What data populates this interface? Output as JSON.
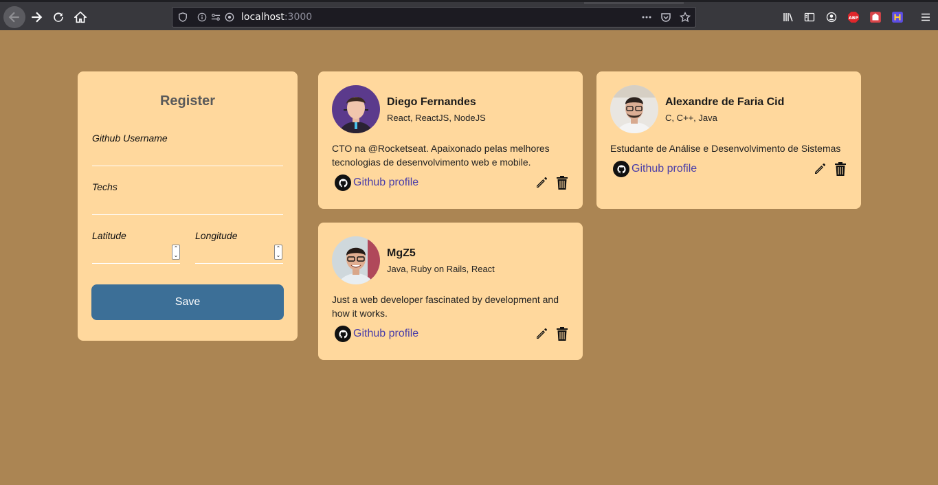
{
  "browser": {
    "url_host": "localhost",
    "url_port": ":3000"
  },
  "register": {
    "title": "Register",
    "github_username_label": "Github Username",
    "github_username_value": "",
    "techs_label": "Techs",
    "techs_value": "",
    "latitude_label": "Latitude",
    "latitude_value": "",
    "longitude_label": "Longitude",
    "longitude_value": "",
    "save_label": "Save"
  },
  "devs": [
    {
      "name": "Diego Fernandes",
      "techs": "React, ReactJS, NodeJS",
      "bio": "CTO na @Rocketseat. Apaixonado pelas melhores tecnologias de desenvolvimento web e mobile.",
      "link_label": "Github profile"
    },
    {
      "name": "Alexandre de Faria Cid",
      "techs": "C, C++, Java",
      "bio": "Estudante de Análise e Desenvolvimento de Sistemas",
      "link_label": "Github profile"
    },
    {
      "name": "MgZ5",
      "techs": "Java, Ruby on Rails, React",
      "bio": "Just a web developer fascinated by development and how it works.",
      "link_label": "Github profile"
    }
  ],
  "colors": {
    "page_background": "#ab8553",
    "card_background": "#ffd89d",
    "save_button": "#3c6f97",
    "link": "#4a3ea8"
  }
}
